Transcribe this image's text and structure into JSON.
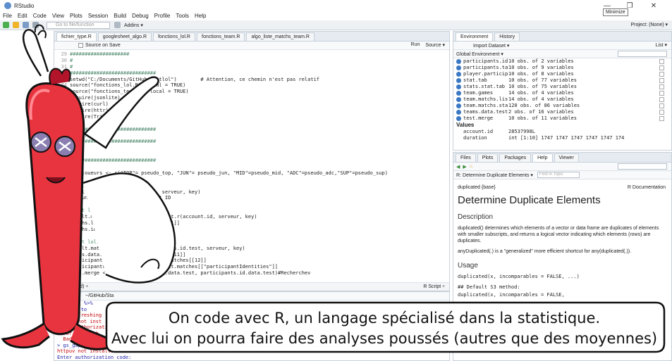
{
  "window": {
    "title": "RStudio",
    "tooltip": "Minimize",
    "controls": [
      "—",
      "❐",
      "✕"
    ]
  },
  "menu": [
    "File",
    "Edit",
    "Code",
    "View",
    "Plots",
    "Session",
    "Build",
    "Debug",
    "Profile",
    "Tools",
    "Help"
  ],
  "toolbar": {
    "goto_placeholder": "Go to file/function",
    "addins": "Addins ▾",
    "project": "Project: (None) ▾"
  },
  "editor": {
    "tabs": [
      "fichier_type.R",
      "googlesheet_algo.R",
      "fonctions_lol.R",
      "fonctions_team.R",
      "algo_liste_matchs_team.R"
    ],
    "source_on_save": "Source on Save",
    "run": "Run",
    "source": "Source ▾",
    "lines": [
      {
        "n": "29",
        "t": "####################"
      },
      {
        "n": "30",
        "t": "#"
      },
      {
        "n": "31",
        "t": "#"
      },
      {
        "n": "32",
        "t": "#############################"
      },
      {
        "n": "33",
        "t": "setwd(\"C:/Documents/GitHub/Statlol\")        # Attention, ce chemin n'est pas relatif"
      },
      {
        "n": "34",
        "t": "source(\"fonctions_lol.R\", local = TRUE)"
      },
      {
        "n": "35",
        "t": "source(\"fonctions_team.R\", local = TRUE)"
      },
      {
        "n": "36",
        "t": "require(jsonlite)"
      },
      {
        "n": "37",
        "t": "require(curl)"
      },
      {
        "n": "38",
        "t": "require(httr)"
      },
      {
        "n": "39",
        "t": "require(TriMatch)"
      },
      {
        "n": "40",
        "t": ""
      },
      {
        "n": "41",
        "t": "#############################"
      },
      {
        "n": "42",
        "t": "#Algorithme"
      },
      {
        "n": "43",
        "t": "#############################"
      },
      {
        "n": "44",
        "t": "#"
      },
      {
        "n": "45",
        "t": "#"
      },
      {
        "n": "46",
        "t": "#############################"
      },
      {
        "n": "47",
        "t": ""
      },
      {
        "n": "48",
        "t": "vec.joueurs <- c(\"TOP\"= pseudo_top, \"JUN\"= pseudo_jun, \"MID\"=pseudo_mid, \"ADC\"=pseudo_adc,\"SUP\"=pseudo_sup)"
      },
      {
        "n": "49",
        "t": ""
      },
      {
        "n": "50",
        "t": "#test lol.player"
      },
      {
        "n": "51",
        "t": "result.id<- lol.player(pseudo, serveur, key)"
      },
      {
        "n": "52",
        "t": "account.id<-result.id[[2]] #Get ID"
      },
      {
        "n": "53",
        "t": ""
      },
      {
        "n": "54",
        "t": "#test lol.matchslist.r"
      },
      {
        "n": "55",
        "t": "result.matchslist <- lol.matchslist.r(account.id, serveur, key)"
      },
      {
        "n": "56",
        "t": "matchs.list <- result.matchslist[[1]]"
      },
      {
        "n": "57",
        "t": "matchs.id.test <- matchs.list[1,2]"
      },
      {
        "n": "58",
        "t": ""
      },
      {
        "n": "59",
        "t": "#test lol.matches"
      },
      {
        "n": "60",
        "t": "result.matches <- lol.matches(matchs.id.test, serveur, key)"
      },
      {
        "n": "61",
        "t": "teams.data.test <- result.matches[[11]]"
      },
      {
        "n": "62",
        "t": "participants.data.test <- result.matches[[12]]"
      },
      {
        "n": "63",
        "t": "participants.id.data.test <- result.matches[[\"participantIdentities\"]]"
      },
      {
        "n": "64",
        "t": "test.merge <- merge(participants.data.test, participants.id.data.test)#Recherchev"
      },
      {
        "n": "65",
        "t": ""
      },
      {
        "n": "66",
        "t": "#############################"
      },
      {
        "n": "67",
        "t": ""
      },
      {
        "n": "68",
        "t": "#test create(\"team_data"
      },
      {
        "n": "69",
        "t": ""
      },
      {
        "n": "70",
        "t": ""
      },
      {
        "n": "71",
        "t": "#test team.player"
      },
      {
        "n": "72",
        "t": "team.ids <- team.player(joueurs,serveur,key)"
      },
      {
        "n": "73",
        "t": ""
      },
      {
        "n": "74",
        "t": "#save"
      }
    ],
    "status_left": "(Untitled) ÷",
    "status_right": "R Script ÷"
  },
  "console": {
    "title": "~/GitHub/Sta",
    "lines": [
      {
        "t": "gs_gap() %>%",
        "c": "blue"
      },
      {
        "t": "gs_copy(to",
        "c": "blue"
      },
      {
        "t": "Auto-refreshing .httr-oauth",
        "c": "red"
      },
      {
        "t": "httpuv not inst",
        "c": "red"
      },
      {
        "t": "enter authorization",
        "c": "red"
      },
      {
        "t": "Error in oauth",
        "c": "red"
      },
      {
        "t": "  Bad Request (",
        "c": "red"
      },
      {
        "t": "> gs_gap() %>%",
        "c": "blue"
      },
      {
        "t": "httpuv not installed",
        "c": "red"
      },
      {
        "t": "Enter authorization code:",
        "c": "blue"
      }
    ]
  },
  "environment": {
    "tabs": [
      "Environment",
      "History"
    ],
    "import": "Import Dataset ▾",
    "list": "List ▾",
    "global": "Global Environment ▾",
    "rows": [
      {
        "name": "participants.id..",
        "desc": "10 obs. of 2 variables"
      },
      {
        "name": "participants.tab",
        "desc": "10 obs. of 9 variables"
      },
      {
        "name": "player.participa..",
        "desc": "10 obs. of 8 variables"
      },
      {
        "name": "stat.tab",
        "desc": "10 obs. of 77 variables"
      },
      {
        "name": "stats.stat.tab",
        "desc": "10 obs. of 75 variables"
      },
      {
        "name": "team.games",
        "desc": "14 obs. of 4 variables"
      },
      {
        "name": "team.matchs.list",
        "desc": "14 obs. of 4 variables"
      },
      {
        "name": "team.matchs.sta..",
        "desc": "120 obs. of 86 variables"
      },
      {
        "name": "teams.data.test",
        "desc": "2 obs. of 16 variables"
      },
      {
        "name": "test.merge",
        "desc": "10 obs. of 11 variables"
      }
    ],
    "values_header": "Values",
    "values": [
      {
        "name": "account.id",
        "desc": "28537998L"
      },
      {
        "name": "duration",
        "desc": "int [1:10] 1747 1747 1747 1747 1747 174"
      }
    ]
  },
  "help": {
    "tabs": [
      "Files",
      "Plots",
      "Packages",
      "Help",
      "Viewer"
    ],
    "topic": "R: Determine Duplicate Elements ▾",
    "find_placeholder": "Find in Topic",
    "pkg": "duplicated {base}",
    "doc": "R Documentation",
    "title": "Determine Duplicate Elements",
    "description_h": "Description",
    "description_p1": "duplicated() determines which elements of a vector or data frame are duplicates of elements with smaller subscripts, and returns a logical vector indicating which elements (rows) are duplicates.",
    "description_p2": "anyDuplicated(.) is a \"generalized\" more efficient shortcut for any(duplicated(.)).",
    "usage_h": "Usage",
    "usage_1": "duplicated(x, incomparables = FALSE, ...)",
    "usage_2": "## Default S3 method:",
    "usage_3": "duplicated(x, incomparables = FALSE,"
  },
  "speech": {
    "line1": "On code avec R, un langage spécialisé dans la statistique.",
    "line2": "Avec lui on pourra faire des analyses poussés (autres que des moyennes)"
  },
  "colors": {
    "mascot_red": "#e8343f",
    "mascot_dark": "#b2142a",
    "bubble_fill": "#ffffff",
    "pane_border": "#c7d0d9",
    "tab_strip": "#e5ebf1"
  }
}
